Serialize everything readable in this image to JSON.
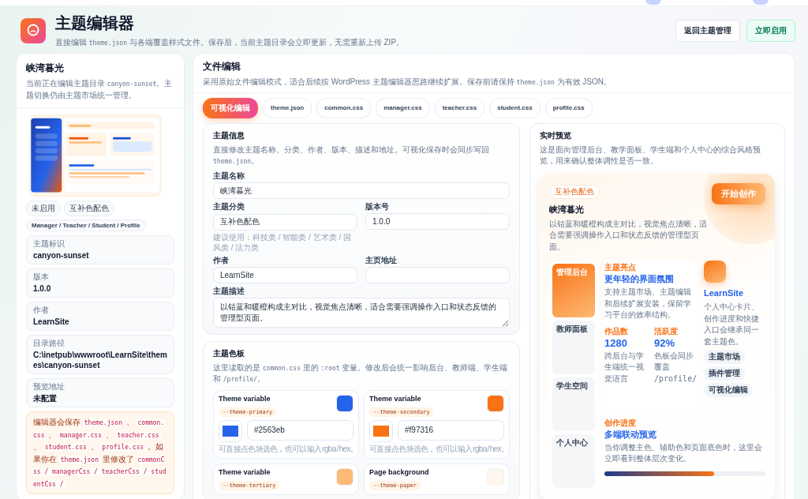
{
  "header": {
    "title": "主题编辑器",
    "subtitle": [
      {
        "text": "直接编辑 "
      },
      {
        "text": "theme.json",
        "code": true
      },
      {
        "text": " 与各端覆盖样式文件。保存后，当前主题目录会立即更新，无需重新上传 ZIP。"
      }
    ],
    "buttons": [
      {
        "label": "返回主题管理",
        "kind": "default"
      },
      {
        "label": "立即启用",
        "kind": "primary"
      }
    ]
  },
  "sidebar": {
    "title": "峡湾暮光",
    "desc": [
      {
        "text": "当前正在编辑主题目录 "
      },
      {
        "text": "canyon-sunset",
        "code": true
      },
      {
        "text": "。主题切换仍由主题市场统一管理。"
      }
    ],
    "tags": [
      "未启用",
      "互补色配色",
      "Manager / Teacher / Student / Profile"
    ],
    "fields": [
      {
        "label": "主题标识",
        "value": "canyon-sunset"
      },
      {
        "label": "版本",
        "value": "1.0.0"
      },
      {
        "label": "作者",
        "value": "LearnSite"
      },
      {
        "label": "目录路径",
        "value": "C:\\inetpub\\wwwroot\\LearnSite\\themes\\canyon-sunset"
      },
      {
        "label": "预览地址",
        "value": "未配置"
      }
    ],
    "note": [
      {
        "text": "编辑器会保存 "
      },
      {
        "text": "theme.json",
        "code": true
      },
      {
        "text": " 、 "
      },
      {
        "text": "common.css",
        "code": true
      },
      {
        "text": " 、 "
      },
      {
        "text": "manager.css",
        "code": true
      },
      {
        "text": " 、 "
      },
      {
        "text": "teacher.css",
        "code": true
      },
      {
        "text": " 、 "
      },
      {
        "text": "student.css",
        "code": true
      },
      {
        "text": " 、 "
      },
      {
        "text": "profile.css",
        "code": true
      },
      {
        "text": " 。如果你在 "
      },
      {
        "text": "theme.json",
        "code": true
      },
      {
        "text": " 里修改了 "
      },
      {
        "text": "commonCss / managerCss / teacherCss / studentCss /",
        "code": true
      }
    ]
  },
  "editor": {
    "title": "文件编辑",
    "desc": [
      {
        "text": "采用原始文件编辑模式，适合后续按 WordPress 主题编辑器思路继续扩展。保存前请保持 "
      },
      {
        "text": "theme.json",
        "code": true
      },
      {
        "text": " 为有效 JSON。"
      }
    ],
    "tabs": [
      {
        "label": "可视化编辑",
        "selected": true
      },
      {
        "label": "theme.json",
        "selected": false
      },
      {
        "label": "common.css",
        "selected": false
      },
      {
        "label": "manager.css",
        "selected": false
      },
      {
        "label": "teacher.css",
        "selected": false
      },
      {
        "label": "student.css",
        "selected": false
      },
      {
        "label": "profile.css",
        "selected": false
      }
    ],
    "info": {
      "title": "主题信息",
      "desc": [
        {
          "text": "直接修改主题名称、分类、作者、版本、描述和地址。可视化保存时会同步写回 "
        },
        {
          "text": "theme.json",
          "code": true
        },
        {
          "text": "。"
        }
      ],
      "fields": [
        {
          "label": "主题名称",
          "value": "峡湾暮光",
          "kind": "full"
        },
        {
          "label": "主题分类",
          "value": "互补色配色",
          "hint": "建议使用：科技类 / 智能类 / 艺术类 / 国风类 / 活力类",
          "kind": "half"
        },
        {
          "label": "版本号",
          "value": "1.0.0",
          "kind": "half"
        },
        {
          "label": "作者",
          "value": "LearnSite",
          "kind": "half"
        },
        {
          "label": "主页地址",
          "kind": "half"
        },
        {
          "label": "主题描述",
          "value": "以钴蓝和暖橙构成主对比，视觉焦点清晰，适合需要强调操作入口和状态反馈的管理型页面。",
          "kind": "textarea"
        }
      ]
    },
    "palette": {
      "title": "主题色板",
      "desc": [
        {
          "text": "这里读取的是 "
        },
        {
          "text": "common.css",
          "code": true
        },
        {
          "text": " 里的 "
        },
        {
          "text": ":root",
          "code": true
        },
        {
          "text": " 变量。修改后会统一影响后台、教师端、学生端和 "
        },
        {
          "text": "/profile/",
          "code": true
        },
        {
          "text": "。"
        }
      ],
      "colors": [
        {
          "title": "Theme variable",
          "var": "--theme-primary",
          "color": "#2563eb",
          "value": "#2563eb",
          "hint": "可直接点色块选色，也可以输入 rgba / hex。"
        },
        {
          "title": "Theme variable",
          "var": "--theme-secondary",
          "color": "#f97316",
          "value": "#f97316",
          "hint": "可直接点色块选色，也可以输入 rgba / hex。"
        },
        {
          "title": "Theme variable",
          "var": "--theme-tertiary",
          "color": "#fdba74"
        },
        {
          "title": "Page background",
          "var": "--theme-paper",
          "color": "#fff7ed"
        }
      ]
    }
  },
  "preview": {
    "title": "实时预览",
    "desc": "这是面向管理后台、教学面板、学生端和个人中心的综合风格预览，用来确认整体调性是否一致。",
    "tag": "互补色配色",
    "name": "峡湾暮光",
    "summary": "以钴蓝和暖橙构成主对比，视觉焦点清晰，适合需要强调操作入口和状态反馈的管理型页面。",
    "cta": "开始创作",
    "nav": [
      {
        "label": "管理后台",
        "selected": true
      },
      {
        "label": "教师面板",
        "selected": false
      },
      {
        "label": "学生空间",
        "selected": false
      },
      {
        "label": "个人中心",
        "selected": false
      }
    ],
    "highlight": {
      "eyebrow": "主题亮点",
      "title": "更年轻的界面氛围",
      "desc": "支持主题市场、主题编辑和后续扩展安装，保留学习平台的效率结构。"
    },
    "stats": [
      {
        "label": "作品数",
        "value": "1280",
        "desc": "跨后台与学生端统一视觉语言"
      },
      {
        "label": "活跃度",
        "value": "92%",
        "desc": [
          {
            "text": "色板会同步覆盖 "
          },
          {
            "text": "/profile/",
            "code": true
          }
        ]
      }
    ],
    "profile": {
      "name": "LearnSite",
      "desc": "个人中心卡片、创作进度和快捷入口会继承同一套主题色。",
      "chips": [
        "主题市场",
        "插件管理",
        "可视化编辑"
      ]
    },
    "progress": {
      "eyebrow": "创作进度",
      "title": "多端联动预览",
      "desc": "当你调整主色、辅助色和页面底色时，这里会立即看到整体层次变化。",
      "level": 0.68
    }
  }
}
